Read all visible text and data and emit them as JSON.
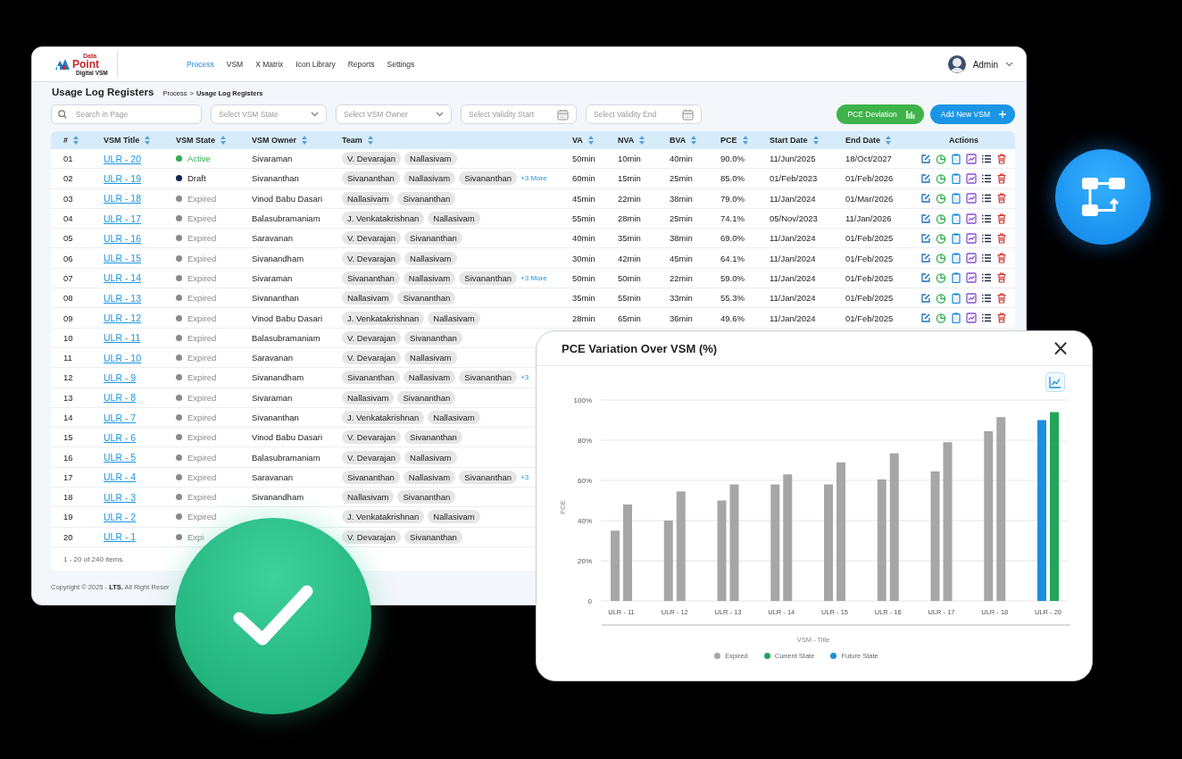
{
  "header": {
    "logo": {
      "top": "Data",
      "main": "Point",
      "sub": "Digital VSM"
    },
    "nav": [
      {
        "label": "Process",
        "selected": true
      },
      {
        "label": "VSM",
        "selected": false
      },
      {
        "label": "X Matrix",
        "selected": false
      },
      {
        "label": "Icon Library",
        "selected": false
      },
      {
        "label": "Reports",
        "selected": false
      },
      {
        "label": "Settings",
        "selected": false
      }
    ],
    "user": "Admin"
  },
  "page": {
    "title": "Usage Log Registers",
    "breadcrumb": {
      "parent": "Process",
      "sep": ">",
      "current": "Usage Log Registers"
    }
  },
  "filters": {
    "search": {
      "placeholder": "Search in Page"
    },
    "selects": [
      {
        "kind": "select",
        "placeholder": "Select VSM State"
      },
      {
        "kind": "select",
        "placeholder": "Select VSM Owner"
      },
      {
        "kind": "date",
        "placeholder": "Select Validity Start"
      },
      {
        "kind": "date",
        "placeholder": "Select Validity End"
      }
    ],
    "buttons": [
      {
        "kind": "chart",
        "label": "PCE Deviation"
      },
      {
        "kind": "add",
        "label": "Add New VSM"
      }
    ]
  },
  "table": {
    "columns": [
      {
        "label": "#",
        "sortable": true
      },
      {
        "label": "VSM Title",
        "sortable": true
      },
      {
        "label": "VSM State",
        "sortable": true
      },
      {
        "label": "VSM Owner",
        "sortable": true
      },
      {
        "label": "Team",
        "sortable": true
      },
      {
        "label": "VA",
        "sortable": true
      },
      {
        "label": "NVA",
        "sortable": true
      },
      {
        "label": "BVA",
        "sortable": true
      },
      {
        "label": "PCE",
        "sortable": true
      },
      {
        "label": "Start Date",
        "sortable": true
      },
      {
        "label": "End Date",
        "sortable": true
      },
      {
        "label": "Actions",
        "sortable": false
      }
    ],
    "rows": [
      {
        "num": "01",
        "title": "ULR - 20",
        "state": "Active",
        "color": "#2fae4f",
        "state_highlight": true,
        "owner": "Sivaraman",
        "team": [
          "V. Devarajan",
          "Nallasivam"
        ],
        "va": "50min",
        "nva": "10min",
        "bva": "40min",
        "pce": "90.0%",
        "start": "11/Jun/2025",
        "end": "18/Oct/2027",
        "actions": true
      },
      {
        "num": "02",
        "title": "ULR - 19",
        "state": "Draft",
        "color": "#0d2450",
        "owner": "Sivananthan",
        "team": [
          "Sivananthan",
          "Nallasivam",
          "Sivananthan"
        ],
        "more": "+3 More",
        "va": "60min",
        "nva": "15min",
        "bva": "25min",
        "pce": "85.0%",
        "start": "01/Feb/2023",
        "end": "01/Feb/2026",
        "actions": true
      },
      {
        "num": "03",
        "title": "ULR - 18",
        "state": "Expired",
        "color": "#8a8a8a",
        "owner": "Vinod Babu Dasari",
        "team": [
          "Nallasivam",
          "Sivananthan"
        ],
        "va": "45min",
        "nva": "22min",
        "bva": "38min",
        "pce": "79.0%",
        "start": "11/Jan/2024",
        "end": "01/Mar/2026",
        "actions": true
      },
      {
        "num": "04",
        "title": "ULR - 17",
        "state": "Expired",
        "color": "#8a8a8a",
        "owner": "Balasubramaniam",
        "team": [
          "J. Venkatakrishnan",
          "Nallasivam"
        ],
        "va": "55min",
        "nva": "28min",
        "bva": "25min",
        "pce": "74.1%",
        "start": "05/Nov/2023",
        "end": "11/Jan/2026",
        "actions": true
      },
      {
        "num": "05",
        "title": "ULR - 16",
        "state": "Expired",
        "color": "#8a8a8a",
        "owner": "Saravanan",
        "team": [
          "V. Devarajan",
          "Sivananthan"
        ],
        "va": "40min",
        "nva": "35min",
        "bva": "38min",
        "pce": "69.0%",
        "start": "11/Jan/2024",
        "end": "01/Feb/2025",
        "actions": true
      },
      {
        "num": "06",
        "title": "ULR - 15",
        "state": "Expired",
        "color": "#8a8a8a",
        "owner": "Sivanandham",
        "team": [
          "V. Devarajan",
          "Nallasivam"
        ],
        "va": "30min",
        "nva": "42min",
        "bva": "45min",
        "pce": "64.1%",
        "start": "11/Jan/2024",
        "end": "01/Feb/2025",
        "actions": true
      },
      {
        "num": "07",
        "title": "ULR - 14",
        "state": "Expired",
        "color": "#8a8a8a",
        "owner": "Sivaraman",
        "team": [
          "Sivananthan",
          "Nallasivam",
          "Sivananthan"
        ],
        "more": "+3 More",
        "va": "50min",
        "nva": "50min",
        "bva": "22min",
        "pce": "59.0%",
        "start": "11/Jan/2024",
        "end": "01/Feb/2025",
        "actions": true
      },
      {
        "num": "08",
        "title": "ULR - 13",
        "state": "Expired",
        "color": "#8a8a8a",
        "owner": "Sivananthan",
        "team": [
          "Nallasivam",
          "Sivananthan"
        ],
        "va": "35min",
        "nva": "55min",
        "bva": "33min",
        "pce": "55.3%",
        "start": "11/Jan/2024",
        "end": "01/Feb/2025",
        "actions": true
      },
      {
        "num": "09",
        "title": "ULR - 12",
        "state": "Expired",
        "color": "#8a8a8a",
        "owner": "Vinod Babu Dasari",
        "team": [
          "J. Venkatakrishnan",
          "Nallasivam"
        ],
        "va": "28min",
        "nva": "65min",
        "bva": "36min",
        "pce": "49.6%",
        "start": "11/Jan/2024",
        "end": "01/Feb/2025",
        "actions": true
      },
      {
        "num": "10",
        "title": "ULR - 11",
        "state": "Expired",
        "color": "#8a8a8a",
        "owner": "Balasubramaniam",
        "team": [
          "V. Devarajan",
          "Sivananthan"
        ]
      },
      {
        "num": "11",
        "title": "ULR - 10",
        "state": "Expired",
        "color": "#8a8a8a",
        "owner": "Saravanan",
        "team": [
          "V. Devarajan",
          "Nallasivam"
        ]
      },
      {
        "num": "12",
        "title": "ULR - 9",
        "state": "Expired",
        "color": "#8a8a8a",
        "owner": "Sivanandham",
        "team": [
          "Sivananthan",
          "Nallasivam",
          "Sivananthan"
        ],
        "more": "+3"
      },
      {
        "num": "13",
        "title": "ULR - 8",
        "state": "Expired",
        "color": "#8a8a8a",
        "owner": "Sivaraman",
        "team": [
          "Nallasivam",
          "Sivananthan"
        ]
      },
      {
        "num": "14",
        "title": "ULR - 7",
        "state": "Expired",
        "color": "#8a8a8a",
        "owner": "Sivananthan",
        "team": [
          "J. Venkatakrishnan",
          "Nallasivam"
        ]
      },
      {
        "num": "15",
        "title": "ULR - 6",
        "state": "Expired",
        "color": "#8a8a8a",
        "owner": "Vinod Babu Dasari",
        "team": [
          "V. Devarajan",
          "Sivananthan"
        ]
      },
      {
        "num": "16",
        "title": "ULR - 5",
        "state": "Expired",
        "color": "#8a8a8a",
        "owner": "Balasubramaniam",
        "team": [
          "V. Devarajan",
          "Nallasivam"
        ]
      },
      {
        "num": "17",
        "title": "ULR - 4",
        "state": "Expired",
        "color": "#8a8a8a",
        "owner": "Saravanan",
        "team": [
          "Sivananthan",
          "Nallasivam",
          "Sivananthan"
        ],
        "more": "+3"
      },
      {
        "num": "18",
        "title": "ULR - 3",
        "state": "Expired",
        "color": "#8a8a8a",
        "owner": "Sivanandham",
        "team": [
          "Nallasivam",
          "Sivananthan"
        ]
      },
      {
        "num": "19",
        "title": "ULR - 2",
        "state": "Expired",
        "color": "#8a8a8a",
        "team": [
          "J. Venkatakrishnan",
          "Nallasivam"
        ]
      },
      {
        "num": "20",
        "title": "ULR - 1",
        "state": "Expi",
        "color": "#8a8a8a",
        "team": [
          "V. Devarajan",
          "Sivananthan"
        ]
      }
    ],
    "count": "1 - 20 of 240 items"
  },
  "footer": "Copyright © 2025 - **LTS.** All Right Reser",
  "modal": {
    "title": "PCE Variation Over VSM (%)",
    "close": "×",
    "chart": {
      "chart_data": {
        "type": "bar",
        "xlabel": "VSM - Title",
        "ylabel": "PCE",
        "grid": true,
        "categories": [
          "ULR - 11",
          "ULR - 12",
          "ULR - 13",
          "ULR - 14",
          "ULR - 15",
          "ULR - 16",
          "ULR - 17",
          "ULR - 18",
          "ULR - 20"
        ],
        "series": [
          {
            "name": "Expired",
            "color": "#a6a6a6",
            "values": [
              35,
              40,
              50,
              58,
              58,
              60.5,
              64.5,
              84.5,
              null
            ]
          },
          {
            "color": "#a6a6a6",
            "values": [
              48,
              54.5,
              58,
              63,
              69,
              73.5,
              79,
              91.5,
              null
            ]
          },
          {
            "name": "Current State",
            "color": "#22a55a",
            "values": [
              null,
              null,
              null,
              null,
              null,
              null,
              null,
              null,
              94
            ]
          },
          {
            "name": "Future State",
            "color": "#1b8fe0",
            "values": [
              null,
              null,
              null,
              null,
              null,
              null,
              null,
              null,
              90
            ]
          }
        ],
        "ylim": [
          0,
          100
        ],
        "yticks": [
          {
            "value": 0,
            "label": "0"
          },
          {
            "value": 20,
            "label": "20%"
          },
          {
            "value": 40,
            "label": "40%"
          },
          {
            "value": 60,
            "label": "60%"
          },
          {
            "value": 80,
            "label": "80%"
          },
          {
            "value": 100,
            "label": "100%"
          }
        ]
      }
    }
  }
}
